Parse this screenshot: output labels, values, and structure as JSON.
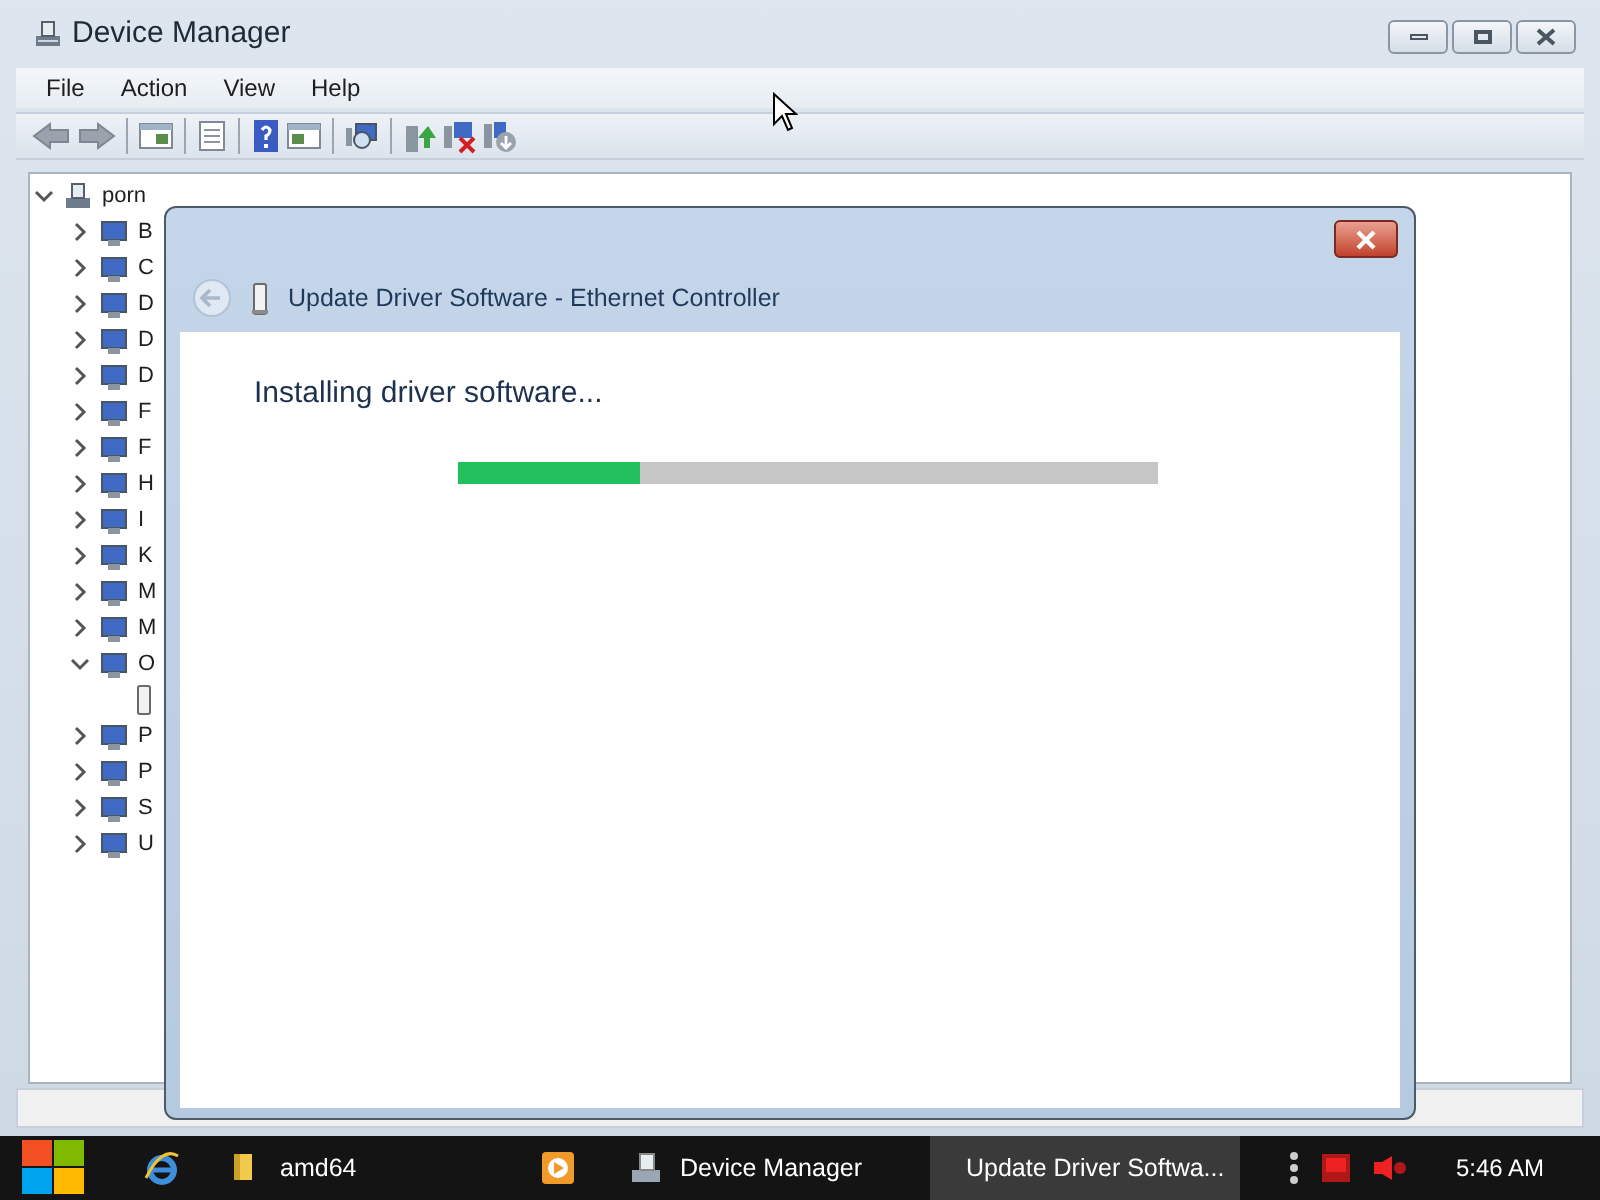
{
  "window": {
    "title": "Device Manager"
  },
  "menu": [
    "File",
    "Action",
    "View",
    "Help"
  ],
  "tree": {
    "label": "porn",
    "expanded": true,
    "children": [
      {
        "label": "B",
        "expanded": false
      },
      {
        "label": "C",
        "expanded": false
      },
      {
        "label": "D",
        "expanded": false
      },
      {
        "label": "D",
        "expanded": false
      },
      {
        "label": "D",
        "expanded": false
      },
      {
        "label": "F",
        "expanded": false
      },
      {
        "label": "F",
        "expanded": false
      },
      {
        "label": "H",
        "expanded": false
      },
      {
        "label": "I",
        "expanded": false
      },
      {
        "label": "K",
        "expanded": false
      },
      {
        "label": "M",
        "expanded": false
      },
      {
        "label": "M",
        "expanded": false
      },
      {
        "label": "O",
        "expanded": true,
        "children": [
          {
            "kind": "device"
          }
        ]
      },
      {
        "label": "P",
        "expanded": false
      },
      {
        "label": "P",
        "expanded": false
      },
      {
        "label": "S",
        "expanded": false
      },
      {
        "label": "U",
        "expanded": false
      }
    ]
  },
  "dialog": {
    "title": "Update Driver Software - Ethernet Controller",
    "heading": "Installing driver software...",
    "progress": {
      "level": 0.26
    }
  },
  "taskbar": {
    "items": [
      {
        "kind": "folder",
        "label": "amd64",
        "selected": false
      },
      {
        "kind": "media",
        "selected": false
      },
      {
        "kind": "devmgr",
        "label": "Device Manager",
        "selected": false
      },
      {
        "kind": "driver",
        "label": "Update Driver Softwa...",
        "selected": true
      }
    ],
    "clock": "5:46 AM"
  }
}
